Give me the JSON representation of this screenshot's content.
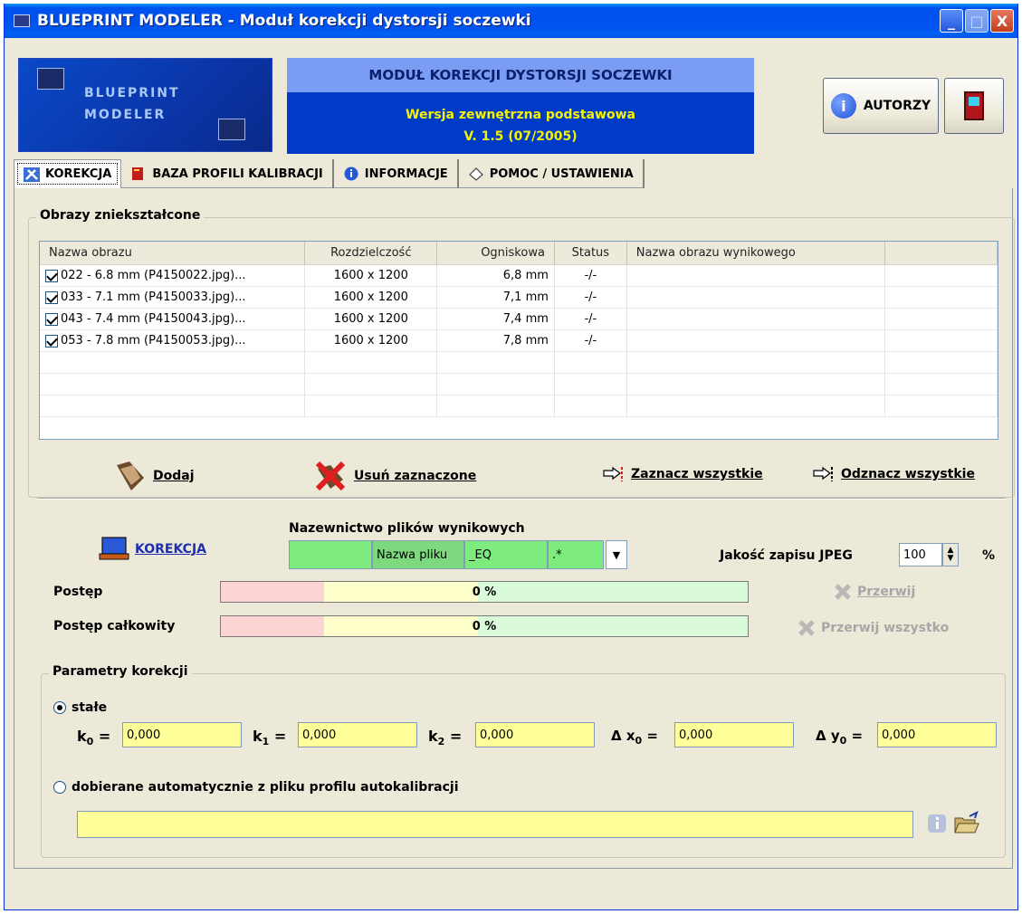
{
  "window": {
    "title": "BLUEPRINT MODELER - Moduł korekcji dystorsji soczewki",
    "minimize": "_",
    "maximize": "□",
    "close": "X"
  },
  "header": {
    "logo_line1": "BLUEPRINT",
    "logo_line2": "MODELER",
    "module_title": "MODUŁ KOREKCJI DYSTORSJI SOCZEWKI",
    "version_line1": "Wersja zewnętrzna podstawowa",
    "version_line2": "V. 1.5  (07/2005)",
    "authors_button": "AUTORZY"
  },
  "tabs": [
    {
      "label": "KOREKCJA",
      "active": true
    },
    {
      "label": "BAZA PROFILI KALIBRACJI"
    },
    {
      "label": "INFORMACJE"
    },
    {
      "label": "POMOC / USTAWIENIA"
    }
  ],
  "images_group": {
    "title": "Obrazy zniekształcone",
    "columns": [
      "Nazwa obrazu",
      "Rozdzielczość",
      "Ogniskowa",
      "Status",
      "Nazwa obrazu wynikowego"
    ],
    "rows": [
      {
        "name": "022 - 6.8 mm (P4150022.jpg)...",
        "resolution": "1600 x 1200",
        "focal": "6,8 mm",
        "status": "-/-",
        "output": "",
        "checked": true
      },
      {
        "name": "033 - 7.1 mm (P4150033.jpg)...",
        "resolution": "1600 x 1200",
        "focal": "7,1 mm",
        "status": "-/-",
        "output": "",
        "checked": true
      },
      {
        "name": "043 - 7.4 mm (P4150043.jpg)...",
        "resolution": "1600 x 1200",
        "focal": "7,4 mm",
        "status": "-/-",
        "output": "",
        "checked": true
      },
      {
        "name": "053 - 7.8 mm (P4150053.jpg)...",
        "resolution": "1600 x 1200",
        "focal": "7,8 mm",
        "status": "-/-",
        "output": "",
        "checked": true
      }
    ],
    "add": "Dodaj",
    "remove_selected": "Usuń zaznaczone",
    "select_all": "Zaznacz wszystkie",
    "deselect_all": "Odznacz wszystkie"
  },
  "correction": {
    "run_label": "KOREKCJA",
    "naming_title": "Nazewnictwo plików wynikowych",
    "prefix_value": "",
    "filename_label": "Nazwa pliku",
    "suffix_value": "_EQ",
    "extension_value": ".*",
    "jpeg_quality_label": "Jakość zapisu JPEG",
    "jpeg_quality_value": "100",
    "jpeg_unit": "%",
    "progress_label": "Postęp",
    "progress_value": "0 %",
    "total_progress_label": "Postęp całkowity",
    "total_progress_value": "0 %",
    "interrupt": "Przerwij",
    "interrupt_all": "Przerwij wszystko"
  },
  "params": {
    "title": "Parametry korekcji",
    "fixed_label": "stałe",
    "k0_label": "k",
    "k0_sub": "0",
    "k0_value": "0,000",
    "k1_label": "k",
    "k1_sub": "1",
    "k1_value": "0,000",
    "k2_label": "k",
    "k2_sub": "2",
    "k2_value": "0,000",
    "dx0_label": "Δ x",
    "dx0_sub": "0",
    "dx0_value": "0,000",
    "dy0_label": "Δ y",
    "dy0_sub": "0",
    "dy0_value": "0,000",
    "equals": "=",
    "auto_label": "dobierane automatycznie z pliku profilu autokalibracji",
    "profile_path": ""
  }
}
